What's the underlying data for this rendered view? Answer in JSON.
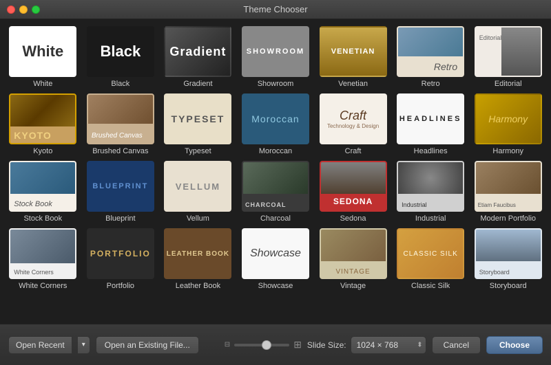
{
  "window": {
    "title": "Theme Chooser"
  },
  "themes": [
    {
      "id": "white",
      "label": "White",
      "style": "white",
      "selected": false
    },
    {
      "id": "black",
      "label": "Black",
      "style": "black",
      "selected": false
    },
    {
      "id": "gradient",
      "label": "Gradient",
      "style": "gradient",
      "selected": false
    },
    {
      "id": "showroom",
      "label": "Showroom",
      "style": "showroom",
      "selected": false
    },
    {
      "id": "venetian",
      "label": "Venetian",
      "style": "venetian",
      "selected": false
    },
    {
      "id": "retro",
      "label": "Retro",
      "style": "retro",
      "selected": false
    },
    {
      "id": "editorial",
      "label": "Editorial",
      "style": "editorial",
      "selected": false
    },
    {
      "id": "kyoto",
      "label": "Kyoto",
      "style": "kyoto",
      "selected": true
    },
    {
      "id": "brushed-canvas",
      "label": "Brushed Canvas",
      "style": "brushed",
      "selected": false
    },
    {
      "id": "typeset",
      "label": "Typeset",
      "style": "typeset",
      "selected": false
    },
    {
      "id": "moroccan",
      "label": "Moroccan",
      "style": "moroccan",
      "selected": false
    },
    {
      "id": "craft",
      "label": "Craft",
      "style": "craft",
      "selected": false
    },
    {
      "id": "headlines",
      "label": "Headlines",
      "style": "headlines",
      "selected": false
    },
    {
      "id": "harmony",
      "label": "Harmony",
      "style": "harmony",
      "selected": false
    },
    {
      "id": "stock-book",
      "label": "Stock Book",
      "style": "stockbook",
      "selected": false
    },
    {
      "id": "blueprint",
      "label": "Blueprint",
      "style": "blueprint",
      "selected": false
    },
    {
      "id": "vellum",
      "label": "Vellum",
      "style": "vellum",
      "selected": false
    },
    {
      "id": "charcoal",
      "label": "Charcoal",
      "style": "charcoal",
      "selected": false
    },
    {
      "id": "sedona",
      "label": "Sedona",
      "style": "sedona",
      "selected": false
    },
    {
      "id": "industrial",
      "label": "Industrial",
      "style": "industrial",
      "selected": false
    },
    {
      "id": "modern-portfolio",
      "label": "Modern Portfolio",
      "style": "modernportfolio",
      "selected": false
    },
    {
      "id": "white-corners",
      "label": "White Corners",
      "style": "whitecorners",
      "selected": false
    },
    {
      "id": "portfolio",
      "label": "Portfolio",
      "style": "portfolio",
      "selected": false
    },
    {
      "id": "leather-book",
      "label": "Leather Book",
      "style": "leatherbook",
      "selected": false
    },
    {
      "id": "showcase",
      "label": "Showcase",
      "style": "showcase",
      "selected": false
    },
    {
      "id": "vintage",
      "label": "Vintage",
      "style": "vintage",
      "selected": false
    },
    {
      "id": "classic-silk",
      "label": "Classic Silk",
      "style": "classicsilk",
      "selected": false
    },
    {
      "id": "storyboard",
      "label": "Storyboard",
      "style": "storyboard",
      "selected": false
    }
  ],
  "bottom": {
    "open_recent": "Open Recent",
    "open_existing": "Open an Existing File...",
    "slide_size_label": "Slide Size:",
    "slide_size_value": "1024 × 768",
    "cancel": "Cancel",
    "choose": "Choose"
  }
}
